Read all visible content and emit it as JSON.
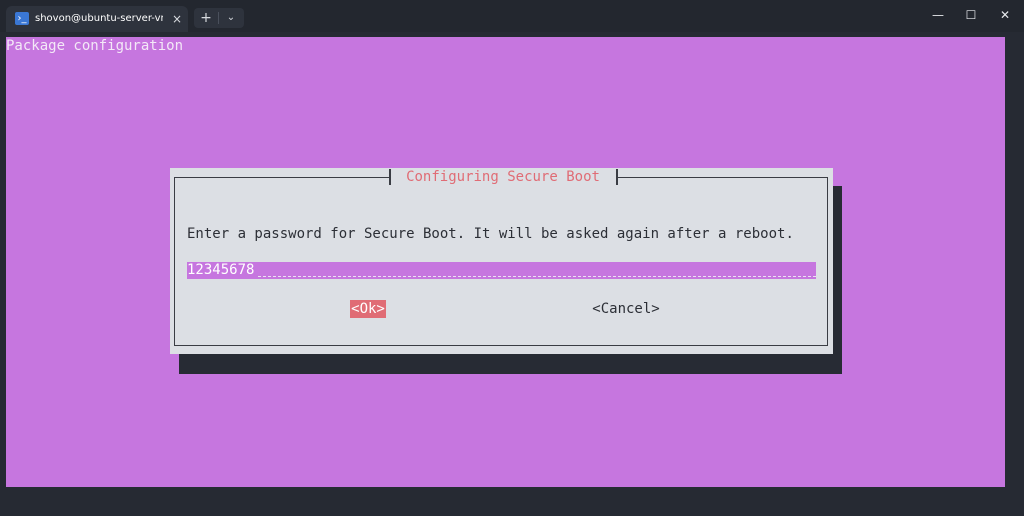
{
  "window": {
    "tab_title": "shovon@ubuntu-server-vm: ~",
    "tab_icon": "powershell-icon",
    "tab_close": "×",
    "new_tab": "+",
    "dropdown": "⌄",
    "minimize": "—",
    "maximize": "☐",
    "close": "✕"
  },
  "terminal": {
    "header": "Package configuration",
    "colors": {
      "background": "#c676df",
      "dialog": "#dcdfe4",
      "accent": "#e06c75",
      "shadow": "#272b34"
    }
  },
  "dialog": {
    "title": " Configuring Secure Boot ",
    "message": "Enter a password for Secure Boot. It will be asked again after a reboot.",
    "password_value": "12345678",
    "ok_label": "<Ok>",
    "cancel_label": "<Cancel>"
  }
}
